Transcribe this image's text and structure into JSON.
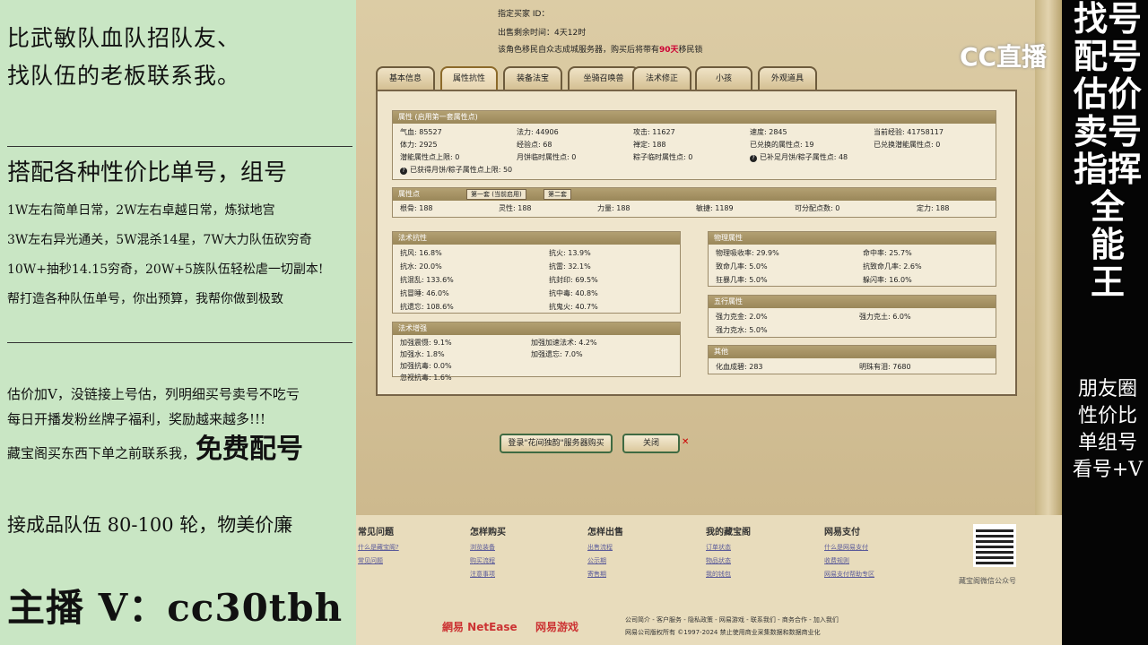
{
  "left_panel": {
    "line1": "比武敏队血队招队友、",
    "line2": "找队伍的老板联系我。",
    "heading": "搭配各种性价比单号，组号",
    "items": [
      "1W左右简单日常，2W左右卓越日常，炼狱地宫",
      "3W左右异光通关，5W混杀14星，7W大力队伍砍穷奇",
      "10W+抽秒14.15穷奇，20W+5族队伍轻松虐一切副本!",
      "帮打造各种队伍单号，你出预算，我帮你做到极致"
    ],
    "valuation1": "估价加V，没链接上号估，列明细买号卖号不吃亏",
    "valuation2": "每日开播发粉丝牌子福利，奖励越来越多!!!",
    "valuation3a": "藏宝阁买东西下单之前联系我，",
    "valuation3b": "免费配号",
    "team": "接成品队伍 80-100 轮，物美价廉",
    "contact": "主播 V：cc30tbh"
  },
  "top_info": {
    "buyer_id": "指定买家 ID：",
    "remaining_label": "出售剩余时间：",
    "remaining_value": "4天12时",
    "notice_pre": "该角色移民自众志成城服务器，购买后将带有",
    "notice_days": "90天",
    "notice_post": "移民锁"
  },
  "tabs": [
    "基本信息",
    "属性抗性",
    "装备法宝",
    "坐骑召唤兽",
    "法术修正",
    "小孩",
    "外观道具"
  ],
  "attributes": {
    "title": "属性 (启用第一套属性点)",
    "rows": [
      [
        [
          "气血:",
          "85527"
        ],
        [
          "法力:",
          "44906"
        ],
        [
          "攻击:",
          "11627"
        ],
        [
          "速度:",
          "2845"
        ],
        [
          "当前经验:",
          "41758117"
        ]
      ],
      [
        [
          "体力:",
          "2925"
        ],
        [
          "经验点:",
          "68"
        ],
        [
          "禅定:",
          "188"
        ],
        [
          "已兑换的属性点:",
          "19"
        ],
        [
          "已兑换潜能属性点:",
          "0"
        ]
      ],
      [
        [
          "潜能属性点上限:",
          "0"
        ],
        [
          "月饼临时属性点:",
          "0"
        ],
        [
          "粽子临时属性点:",
          "0"
        ],
        [
          "已补足月饼/粽子属性点:",
          "48"
        ]
      ],
      [
        [
          "已获得月饼/粽子属性点上限:",
          "50"
        ]
      ]
    ]
  },
  "points": {
    "title": "属性点",
    "tab1": "第一套 (当前启用)",
    "tab2": "第二套",
    "values": [
      [
        "根骨:",
        "188"
      ],
      [
        "灵性:",
        "188"
      ],
      [
        "力量:",
        "188"
      ],
      [
        "敏捷:",
        "1189"
      ],
      [
        "可分配点数:",
        "0"
      ],
      [
        "定力:",
        "188"
      ]
    ]
  },
  "resist": {
    "title": "法术抗性",
    "left": [
      [
        "抗风:",
        "16.8%"
      ],
      [
        "抗水:",
        "20.0%"
      ],
      [
        "抗混乱:",
        "133.6%"
      ],
      [
        "抗冒睡:",
        "46.0%"
      ],
      [
        "抗遗忘:",
        "108.6%"
      ]
    ],
    "right": [
      [
        "抗火:",
        "13.9%"
      ],
      [
        "抗雷:",
        "32.1%"
      ],
      [
        "抗封印:",
        "69.5%"
      ],
      [
        "抗中毒:",
        "40.8%"
      ],
      [
        "抗鬼火:",
        "40.7%"
      ]
    ]
  },
  "enhance": {
    "title": "法术增强",
    "left": [
      [
        "加强震慑:",
        "9.1%"
      ],
      [
        "加强水:",
        "1.8%"
      ],
      [
        "加强抗毒:",
        "0.0%"
      ],
      [
        "忽视抗毒:",
        "1.6%"
      ]
    ],
    "right": [
      [
        "加强加速法术:",
        "4.2%"
      ],
      [
        "加强遗忘:",
        "7.0%"
      ]
    ]
  },
  "physical": {
    "title": "物理属性",
    "left": [
      [
        "物理吸收率:",
        "29.9%"
      ],
      [
        "致命几率:",
        "5.0%"
      ],
      [
        "狂暴几率:",
        "5.0%"
      ]
    ],
    "right": [
      [
        "命中率:",
        "25.7%"
      ],
      [
        "抗致命几率:",
        "2.6%"
      ],
      [
        "躲闪率:",
        "16.0%"
      ]
    ]
  },
  "five": {
    "title": "五行属性",
    "left": [
      [
        "强力克金:",
        "2.0%"
      ],
      [
        "强力克水:",
        "5.0%"
      ]
    ],
    "right": [
      [
        "强力克土:",
        "6.0%"
      ]
    ]
  },
  "other": {
    "title": "其他",
    "left": [
      [
        "化血成碧:",
        "283"
      ]
    ],
    "right": [
      [
        "明珠有泪:",
        "7680"
      ]
    ]
  },
  "buttons": {
    "login": "登录\"花间独韵\"服务器购买",
    "close": "关闭"
  },
  "footer": {
    "cols": [
      {
        "h": "常见问题",
        "links": [
          "什么是藏宝阁?",
          "常见问题"
        ]
      },
      {
        "h": "怎样购买",
        "links": [
          "浏览装备",
          "购买流程",
          "注意事项"
        ]
      },
      {
        "h": "怎样出售",
        "links": [
          "出售流程",
          "公示期",
          "寄售期"
        ]
      },
      {
        "h": "我的藏宝阁",
        "links": [
          "订单状态",
          "物品状态",
          "我的钱包"
        ]
      },
      {
        "h": "网易支付",
        "links": [
          "什么是网易支付",
          "收费规则",
          "网易支付帮助专区"
        ]
      }
    ],
    "qr_caption": "藏宝阁微信公众号",
    "brand1": "網易 NetEase",
    "brand2": "网易游戏",
    "links_line": "公司简介 - 客户服务 - 隐私政策 - 网易游戏 - 联系我们 - 商务合作 - 加入我们",
    "copyright": "网易公司版权所有 ©1997-2024 禁止使用商业采集数据和数据商业化"
  },
  "logo": "CC直播",
  "right_banner": {
    "vertical": [
      "找号",
      "配号",
      "估价",
      "卖号",
      "指挥",
      "全",
      "能",
      "王"
    ],
    "lines": [
      "朋友圈",
      "性价比",
      "单组号",
      "看号+V"
    ]
  }
}
